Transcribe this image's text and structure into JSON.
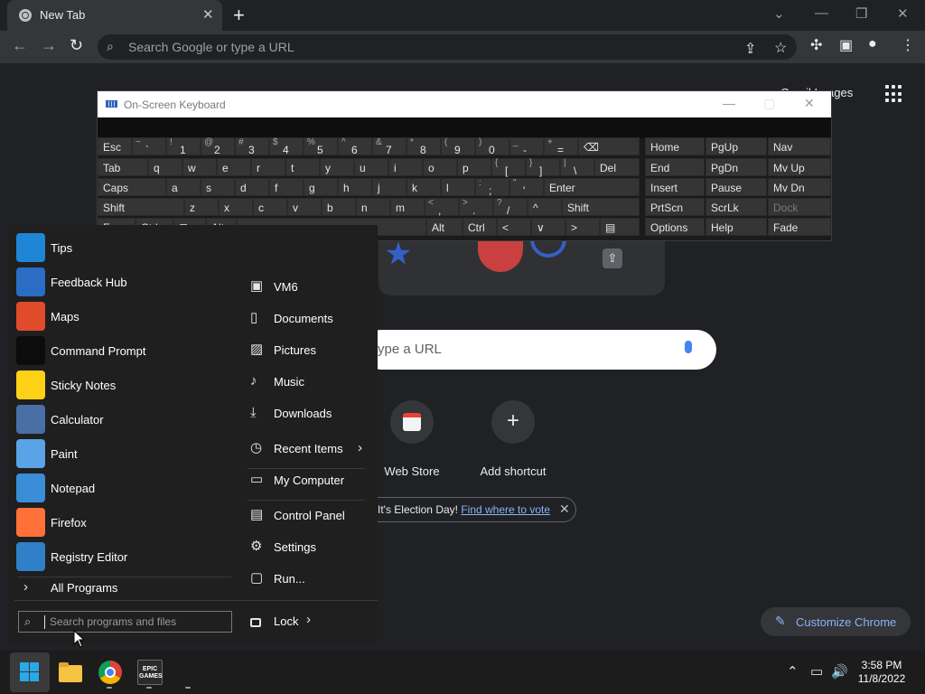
{
  "chrome": {
    "tab_title": "New Tab",
    "close_tab": "✕",
    "new_tab": "+",
    "window_controls": [
      "⌄",
      "—",
      "❐",
      "✕"
    ],
    "omnibox_placeholder": "Search Google or type a URL",
    "toolbar_icons": [
      "back-icon",
      "forward-icon",
      "reload-icon",
      "share-icon",
      "star-icon",
      "extensions-icon",
      "side-panel-icon",
      "profile-icon",
      "menu-icon"
    ]
  },
  "ntp": {
    "top_links": "Gmail  Images",
    "search_placeholder": "ype a URL",
    "shortcuts": [
      {
        "label": "Web Store"
      },
      {
        "label": "Add shortcut",
        "glyph": "+"
      }
    ],
    "promo_text": "It's Election Day! ",
    "promo_link": "Find where to vote",
    "promo_close": "✕",
    "customize_label": "Customize Chrome",
    "customize_glyph": "✎"
  },
  "osk": {
    "title": "On-Screen Keyboard",
    "rows": [
      [
        "Esc",
        "~ `",
        "! 1",
        "@ 2",
        "# 3",
        "$ 4",
        "% 5",
        "^ 6",
        "& 7",
        "* 8",
        "( 9",
        ") 0",
        "_ -",
        "+ =",
        "⌫",
        "Home",
        "PgUp",
        "Nav"
      ],
      [
        "Tab",
        "q",
        "w",
        "e",
        "r",
        "t",
        "y",
        "u",
        "i",
        "o",
        "p",
        "{ [",
        "} ]",
        "| \\",
        "Del",
        "End",
        "PgDn",
        "Mv Up"
      ],
      [
        "Caps",
        "a",
        "s",
        "d",
        "f",
        "g",
        "h",
        "j",
        "k",
        "l",
        ": ;",
        "\" '",
        "Enter",
        "Insert",
        "Pause",
        "Mv Dn"
      ],
      [
        "Shift",
        "z",
        "x",
        "c",
        "v",
        "b",
        "n",
        "m",
        "< ,",
        "> .",
        "? /",
        "^",
        "Shift",
        "PrtScn",
        "ScrLk",
        "Dock"
      ],
      [
        "Fn",
        "Ctrl",
        "⊞",
        "Alt",
        "",
        "Alt",
        "Ctrl",
        "<",
        "∨",
        ">",
        "▤",
        "Options",
        "Help",
        "Fade"
      ]
    ]
  },
  "start_menu": {
    "apps": [
      {
        "label": "Tips",
        "icon": "tips-icon",
        "color": "#1f86d6"
      },
      {
        "label": "Feedback Hub",
        "icon": "feedback-hub-icon",
        "color": "#2b6cc4"
      },
      {
        "label": "Maps",
        "icon": "maps-icon",
        "color": "#e04b2c"
      },
      {
        "label": "Command Prompt",
        "icon": "command-prompt-icon",
        "color": "#0c0c0c"
      },
      {
        "label": "Sticky Notes",
        "icon": "sticky-notes-icon",
        "color": "#fcd116"
      },
      {
        "label": "Calculator",
        "icon": "calculator-icon",
        "color": "#4a6fa5"
      },
      {
        "label": "Paint",
        "icon": "paint-icon",
        "color": "#5aa3e6"
      },
      {
        "label": "Notepad",
        "icon": "notepad-icon",
        "color": "#3a8dd6"
      },
      {
        "label": "Firefox",
        "icon": "firefox-icon",
        "color": "#ff7139"
      },
      {
        "label": "Registry Editor",
        "icon": "registry-editor-icon",
        "color": "#2f7fc9"
      }
    ],
    "all_programs": "All Programs",
    "all_programs_glyph": "›",
    "places": [
      {
        "label": "VM6",
        "icon": "user-folder-icon",
        "glyph": "▣"
      },
      {
        "label": "Documents",
        "icon": "documents-icon",
        "glyph": "▯"
      },
      {
        "label": "Pictures",
        "icon": "pictures-icon",
        "glyph": "▨"
      },
      {
        "label": "Music",
        "icon": "music-icon",
        "glyph": "♪"
      },
      {
        "label": "Downloads",
        "icon": "downloads-icon",
        "glyph": "⤓"
      },
      {
        "label": "Recent Items",
        "icon": "recent-items-icon",
        "glyph": "◷",
        "arrow": "›"
      },
      {
        "label": "My Computer",
        "icon": "my-computer-icon",
        "glyph": "▭"
      },
      {
        "label": "Control Panel",
        "icon": "control-panel-icon",
        "glyph": "▤"
      },
      {
        "label": "Settings",
        "icon": "settings-icon",
        "glyph": "⚙"
      },
      {
        "label": "Run...",
        "icon": "run-icon",
        "glyph": "▢"
      }
    ],
    "search_placeholder": "Search programs and files",
    "lock_label": "Lock",
    "lock_arrow": "›"
  },
  "taskbar": {
    "time": "3:58 PM",
    "date": "11/8/2022",
    "tray_glyphs": [
      "⌃",
      "▭",
      "🔊"
    ],
    "epic_label": "EPIC GAMES"
  }
}
